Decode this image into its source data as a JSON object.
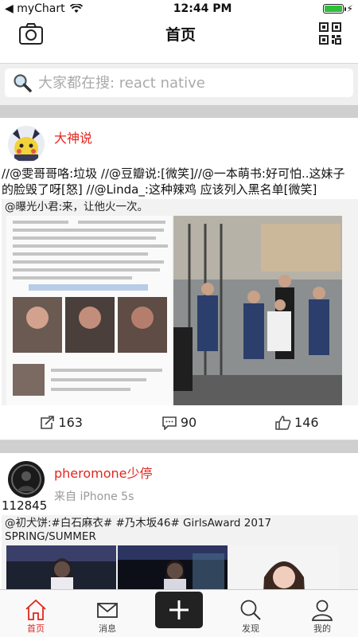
{
  "status_bar": {
    "back_app": "myChart",
    "time": "12:44 PM"
  },
  "nav": {
    "title": "首页"
  },
  "search": {
    "placeholder": "大家都在搜: react native"
  },
  "posts": [
    {
      "username": "大神说",
      "text": "//@雯哥哥咯:垃圾 //@豆瓣说:[微笑]//@一本萌书:好可怕..这妹子的脸毁了呀[怒] //@Linda_:这种辣鸡 应该列入黑名单[微笑]",
      "repost_text": "@曝光小君:来，让他火一次。",
      "shares": "163",
      "comments": "90",
      "likes": "146"
    },
    {
      "username": "pheromone少停",
      "from": "来自  iPhone 5s",
      "text": "112845",
      "repost_text": "@初犬饼:#白石麻衣# #乃木坂46# GirlsAward 2017 SPRING/SUMMER"
    }
  ],
  "tabs": [
    {
      "label": "首页",
      "icon": "home-icon"
    },
    {
      "label": "消息",
      "icon": "mail-icon"
    },
    {
      "label": "",
      "icon": "plus-icon"
    },
    {
      "label": "发现",
      "icon": "search-icon"
    },
    {
      "label": "我的",
      "icon": "user-icon"
    }
  ],
  "colors": {
    "accent": "#e3261f",
    "separator": "#cfcfcf",
    "battery": "#2fbf3a"
  }
}
